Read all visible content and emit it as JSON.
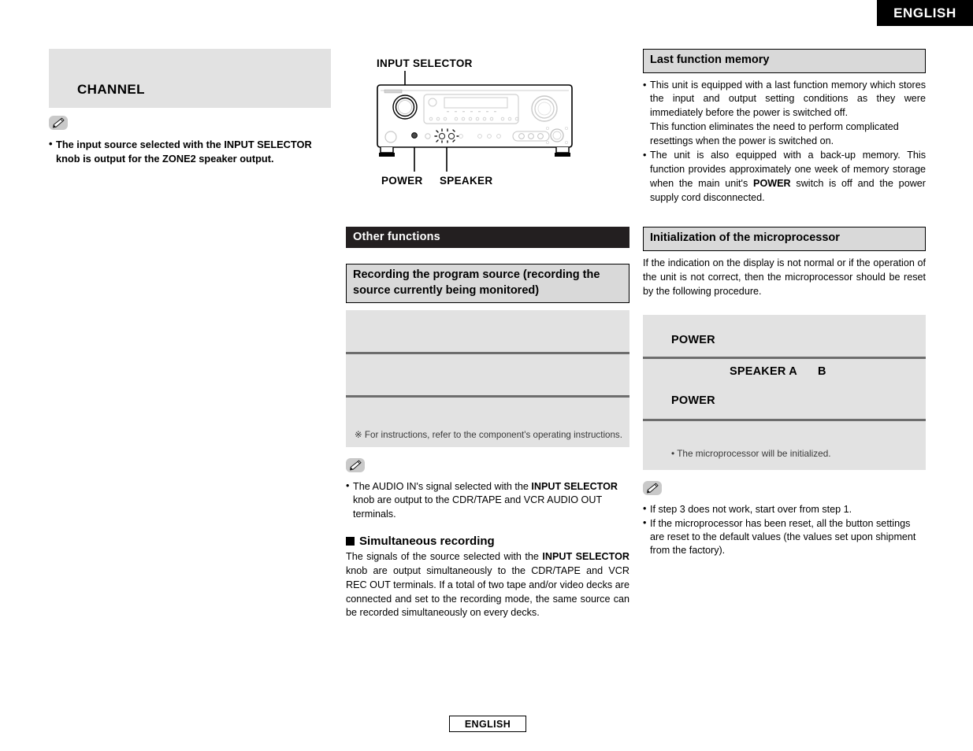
{
  "page": {
    "language_tab_top": "ENGLISH",
    "language_tab_bottom": "ENGLISH"
  },
  "left_column": {
    "channel_heading": "CHANNEL",
    "note_icon": "pencil-note-icon",
    "notes": [
      "The input source selected with the INPUT SELECTOR knob is output for the ZONE2 speaker output."
    ]
  },
  "middle_column": {
    "diagram": {
      "name": "av-receiver-front-panel",
      "callout_input_selector": "INPUT SELECTOR",
      "callout_power": "POWER",
      "callout_speaker": "SPEAKER"
    },
    "section_bar": "Other functions",
    "recording_heading": "Recording the program source (recording the source currently being monitored)",
    "recording_steps": [
      "",
      "",
      ""
    ],
    "recording_footnote": "※  For instructions, refer to the component's operating instructions.",
    "note_icon": "pencil-note-icon",
    "notes": [
      "The AUDIO IN's signal selected with the INPUT SELECTOR knob are output to the CDR/TAPE and VCR AUDIO OUT terminals."
    ],
    "note_bold_terms": [
      "INPUT SELECTOR"
    ],
    "simultaneous_heading": "Simultaneous recording",
    "simultaneous_body_part1": "The signals of the source selected with the ",
    "simultaneous_body_bold": "INPUT SELECTOR",
    "simultaneous_body_part2": " knob are output simultaneously to the CDR/TAPE and VCR REC OUT terminals. If a total of two tape and/or video decks are connected and set to the recording mode, the same source can be recorded simultaneously on every decks."
  },
  "right_column": {
    "last_memory_heading": "Last function memory",
    "last_memory_bullets": [
      {
        "paragraphs": [
          "This unit is equipped with a last function memory which stores the input and output setting conditions as they were immediately before the power is switched off.",
          "This function eliminates the need to perform complicated resettings when the power is switched on."
        ]
      },
      {
        "text_part1": "The unit is also equipped with a back-up memory. This function provides approximately one week of memory storage when the main unit's ",
        "bold": "POWER",
        "text_part2": " switch is off and the power supply cord disconnected."
      }
    ],
    "init_heading": "Initialization of the microprocessor",
    "init_intro": "If the indication on the display is not normal or if the operation of the unit is not correct, then the microprocessor should be reset by the following procedure.",
    "init_steps": [
      {
        "labels": [
          "POWER"
        ]
      },
      {
        "labels": [
          "SPEAKER A",
          "B",
          "POWER"
        ]
      },
      {
        "note": "• The microprocessor will be initialized."
      }
    ],
    "note_icon": "pencil-note-icon",
    "notes": [
      "If step 3 does not work, start over from step 1.",
      "If the microprocessor has been reset, all the button settings are reset to the default values (the values set upon shipment from the factory)."
    ]
  },
  "colors": {
    "bar_black": "#231f20",
    "panel_gray": "#e2e2e2",
    "heading_gray": "#d9d9d9",
    "divider_gray": "#6d6d6d"
  }
}
